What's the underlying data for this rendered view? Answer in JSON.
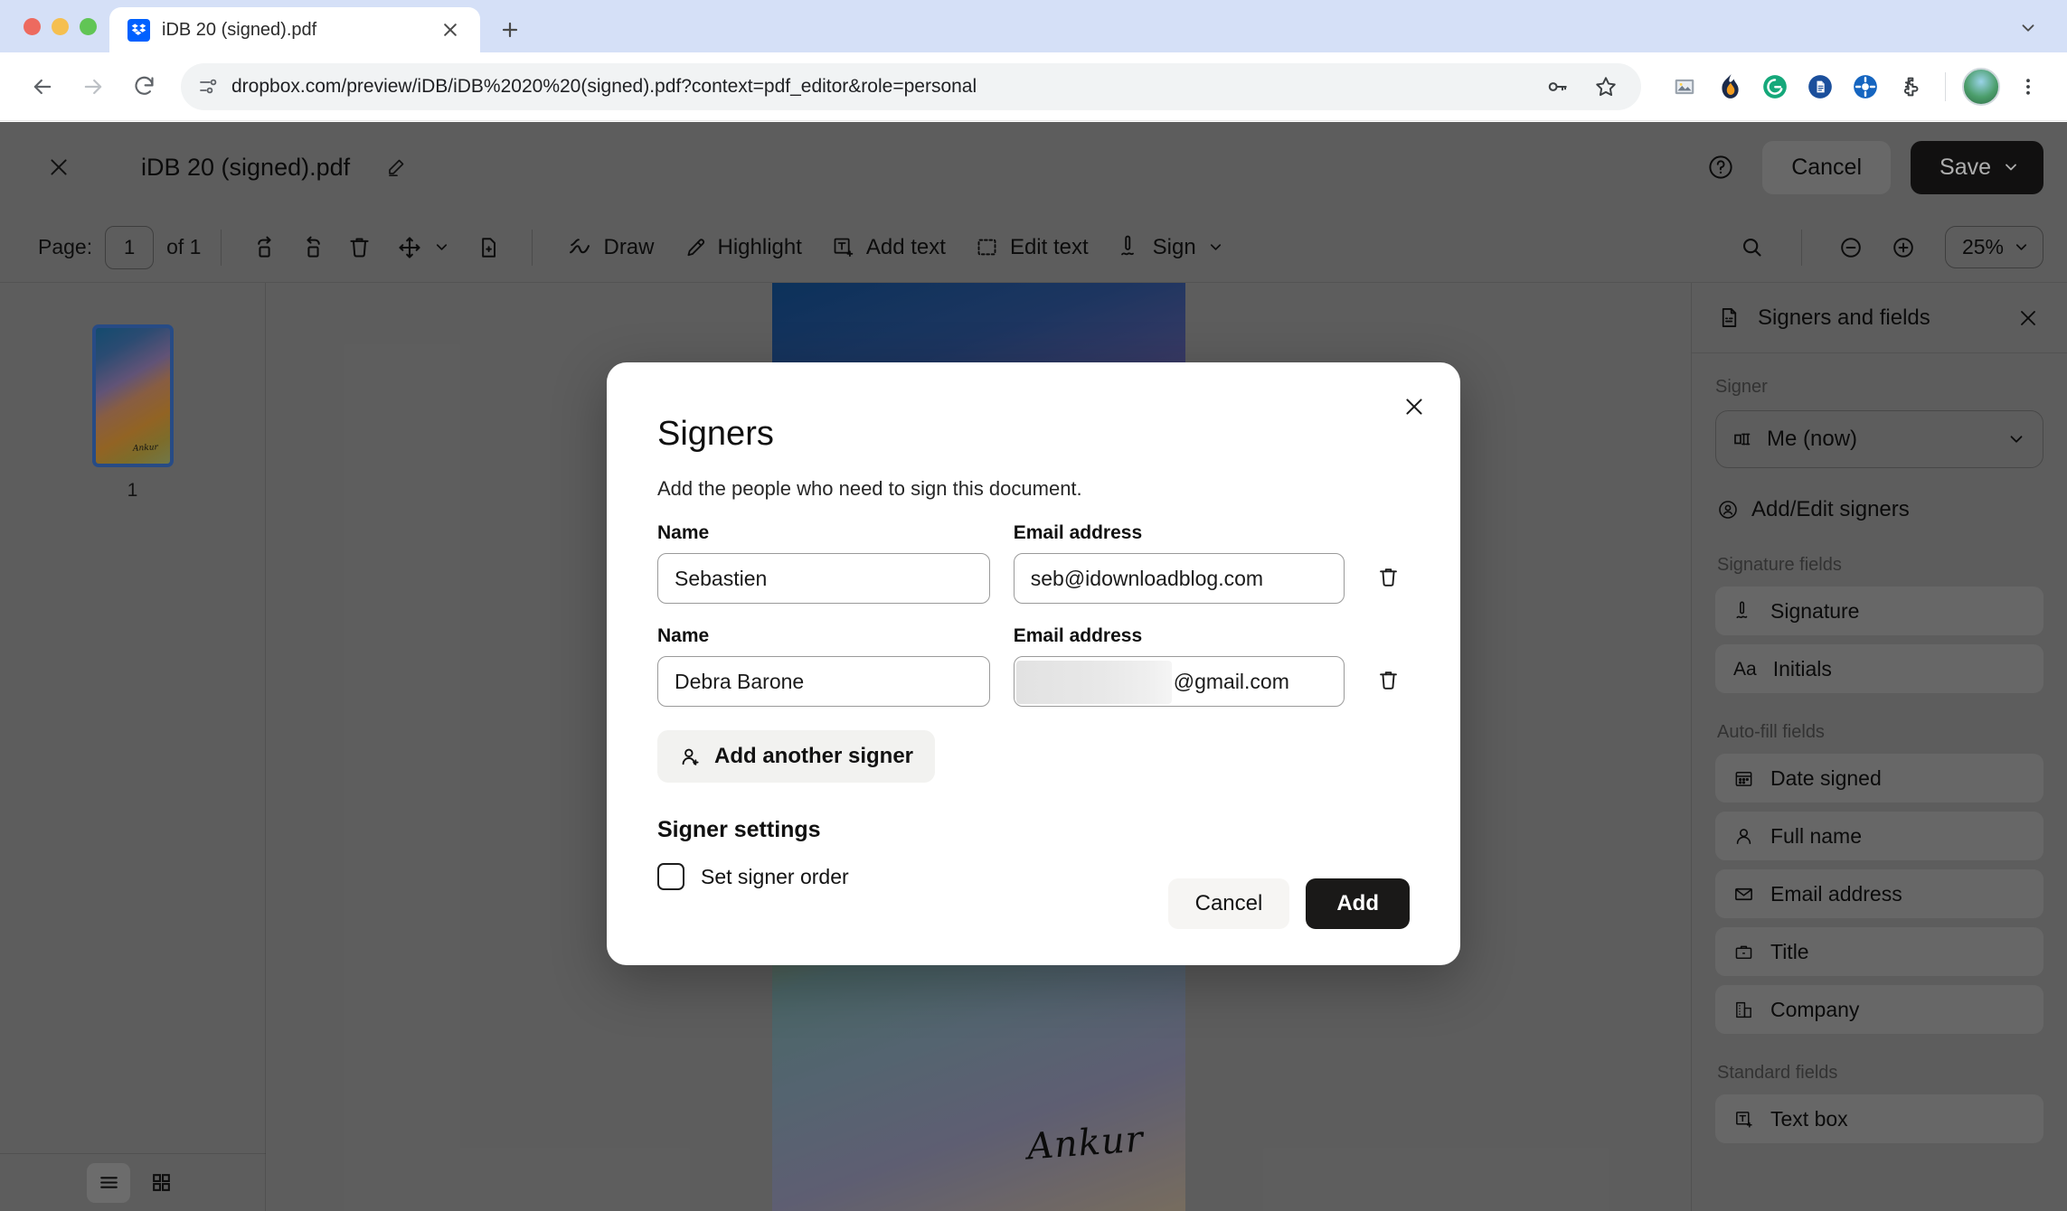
{
  "browser": {
    "tab": {
      "title": "iDB 20 (signed).pdf",
      "favicon": "dropbox-icon"
    },
    "new_tab_label": "+",
    "url": "dropbox.com/preview/iDB/iDB%2020%20(signed).pdf?context=pdf_editor&role=personal",
    "omnibox_icons": [
      "site-settings-icon",
      "password-key-icon",
      "bookmark-star-icon"
    ],
    "extensions": [
      "screenshot-icon",
      "flame-icon",
      "grammarly-icon",
      "document-icon",
      "target-icon",
      "puzzle-extensions-icon"
    ],
    "profile": "avatar",
    "menu": "kebab-menu-icon"
  },
  "app_header": {
    "close_label": "×",
    "document_title": "iDB 20 (signed).pdf",
    "rename_icon": "pencil-icon",
    "help_icon": "help-circle-icon",
    "cancel_label": "Cancel",
    "save_label": "Save"
  },
  "toolbar": {
    "page_label": "Page:",
    "page_value": "1",
    "page_of": "of 1",
    "icons": [
      "rotate-right-icon",
      "rotate-left-icon",
      "trash-icon",
      "move-tool-icon",
      "add-page-icon"
    ],
    "tools": [
      {
        "label": "Draw",
        "icon": "draw-icon"
      },
      {
        "label": "Highlight",
        "icon": "highlight-pen-icon"
      },
      {
        "label": "Add text",
        "icon": "add-text-icon"
      },
      {
        "label": "Edit text",
        "icon": "edit-text-icon"
      },
      {
        "label": "Sign",
        "icon": "sign-pen-icon"
      }
    ],
    "search_icon": "search-icon",
    "zoom_out_icon": "zoom-out-icon",
    "zoom_in_icon": "zoom-in-icon",
    "zoom_level": "25%"
  },
  "thumbnails": {
    "page_number": "1",
    "signature_text": "Ankur",
    "list_view_icon": "list-view-icon",
    "grid_view_icon": "grid-view-icon"
  },
  "document": {
    "signature_text": "Ankur"
  },
  "right_panel": {
    "title": "Signers and fields",
    "panel_icon": "signed-document-icon",
    "close_icon": "close-icon",
    "signer_label": "Signer",
    "signer_value": "Me (now)",
    "signer_icon": "signer-tag-icon",
    "add_edit_signers": "Add/Edit signers",
    "add_edit_icon": "user-circle-icon",
    "groups": [
      {
        "label": "Signature fields",
        "items": [
          {
            "label": "Signature",
            "icon": "sign-pen-icon"
          },
          {
            "label": "Initials",
            "icon": "initials-aa-icon"
          }
        ]
      },
      {
        "label": "Auto-fill fields",
        "items": [
          {
            "label": "Date signed",
            "icon": "calendar-icon"
          },
          {
            "label": "Full name",
            "icon": "person-icon"
          },
          {
            "label": "Email address",
            "icon": "envelope-icon"
          },
          {
            "label": "Title",
            "icon": "briefcase-icon"
          },
          {
            "label": "Company",
            "icon": "building-icon"
          }
        ]
      },
      {
        "label": "Standard fields",
        "items": [
          {
            "label": "Text box",
            "icon": "add-text-icon"
          }
        ]
      }
    ]
  },
  "modal": {
    "title": "Signers",
    "subtitle": "Add the people who need to sign this document.",
    "close_icon": "close-icon",
    "name_label": "Name",
    "email_label": "Email address",
    "signers": [
      {
        "name": "Sebastien",
        "email": "seb@idownloadblog.com",
        "redacted": false
      },
      {
        "name": "Debra Barone",
        "email": "@gmail.com",
        "redacted": true
      }
    ],
    "delete_icon": "trash-icon",
    "add_another_signer": "Add another signer",
    "add_signer_icon": "add-user-icon",
    "settings_title": "Signer settings",
    "set_signer_order_label": "Set signer order",
    "set_signer_order_checked": false,
    "cancel_label": "Cancel",
    "add_label": "Add"
  },
  "colors": {
    "brand_blue": "#0061ff",
    "dark_button": "#1a1918",
    "chrome_tabstrip": "#d5e0f7",
    "app_background": "#8a8a8a"
  }
}
